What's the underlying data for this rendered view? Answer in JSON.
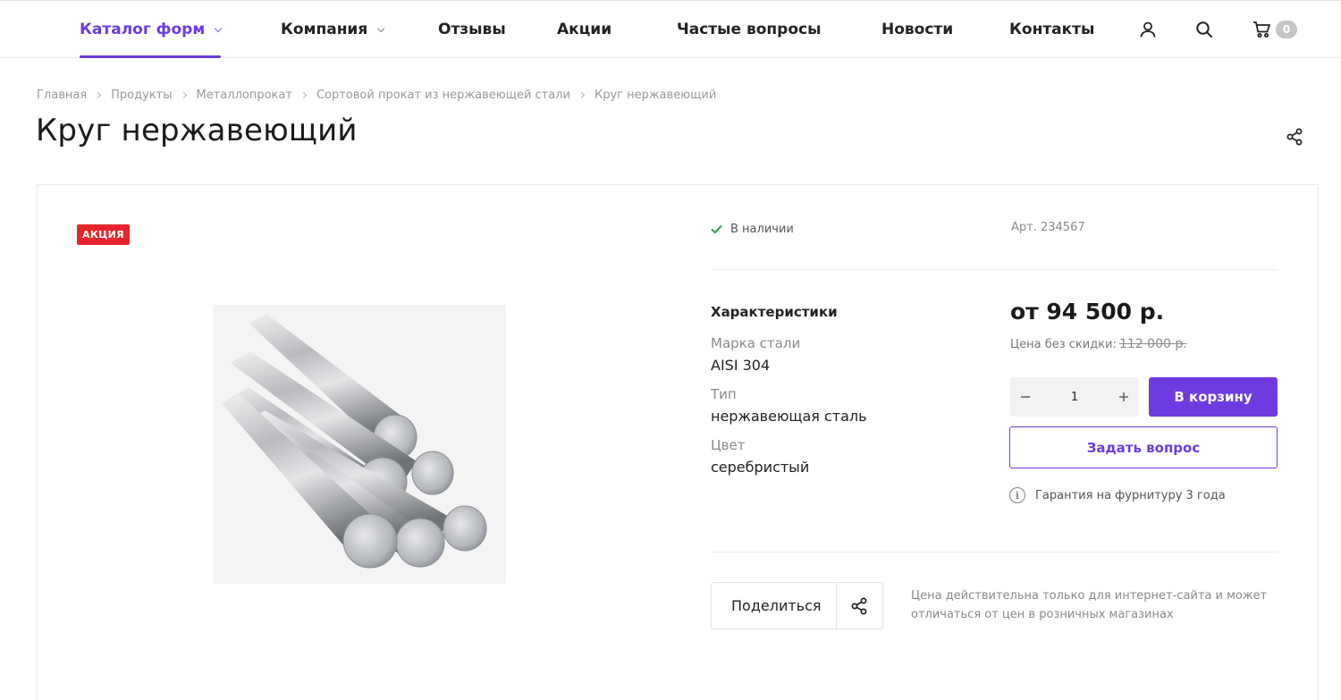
{
  "header": {
    "nav": [
      {
        "label": "Каталог форм",
        "active": true,
        "has_dropdown": true
      },
      {
        "label": "Компания",
        "active": false,
        "has_dropdown": true
      },
      {
        "label": "Отзывы",
        "active": false,
        "has_dropdown": false
      },
      {
        "label": "Акции",
        "active": false,
        "has_dropdown": false
      },
      {
        "label": "Частые вопросы",
        "active": false,
        "has_dropdown": false
      },
      {
        "label": "Новости",
        "active": false,
        "has_dropdown": false
      },
      {
        "label": "Контакты",
        "active": false,
        "has_dropdown": false
      }
    ],
    "icons": [
      "user-icon",
      "search-icon",
      "cart-icon"
    ],
    "cart_count": "0"
  },
  "breadcrumb": [
    "Главная",
    "Продукты",
    "Металлопрокат",
    "Сортовой прокат из нержавеющей стали",
    "Круг нержавеющий"
  ],
  "page": {
    "title": "Круг нержавеющий"
  },
  "product": {
    "badge": "АКЦИЯ",
    "image_icon": "steel-rods-image",
    "availability": "В наличии",
    "article": "Арт. 234567",
    "characteristics_title": "Характеристики",
    "characteristics": [
      {
        "label": "Марка стали",
        "value": "AISI 304"
      },
      {
        "label": "Тип",
        "value": "нержавеющая сталь"
      },
      {
        "label": "Цвет",
        "value": "серебристый"
      }
    ],
    "price": "от 94 500 р.",
    "old_price_label": "Цена без скидки:",
    "old_price": "112 000 р.",
    "quantity": "1",
    "add_to_cart": "В корзину",
    "ask_question": "Задать вопрос",
    "warranty": "Гарантия на фурнитуру 3 года",
    "share_label": "Поделиться",
    "price_note": "Цена действительна только для интернет-сайта и может отличаться от цен в розничных магазинах"
  },
  "colors": {
    "accent": "#6e3be0",
    "badge_red": "#e5272d",
    "in_stock_green": "#2ba24c",
    "muted_text": "#8a8a8a"
  }
}
